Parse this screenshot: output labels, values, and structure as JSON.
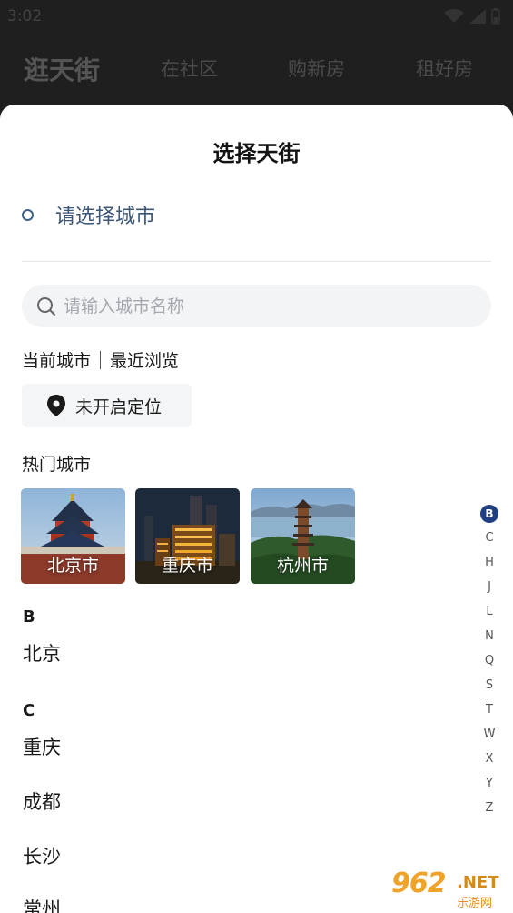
{
  "status_bar": {
    "time": "3:02"
  },
  "background_nav": {
    "tabs": [
      "逛天街",
      "在社区",
      "购新房",
      "租好房"
    ]
  },
  "sheet": {
    "title": "选择天街",
    "select_prompt": "请选择城市",
    "search": {
      "placeholder": "请输入城市名称",
      "value": ""
    },
    "tabs": [
      "当前城市",
      "最近浏览"
    ],
    "location_button": {
      "label": "未开启定位",
      "icon": "location-pin-icon"
    },
    "hot_title": "热门城市",
    "hot_cities": [
      {
        "label": "北京市"
      },
      {
        "label": "重庆市"
      },
      {
        "label": "杭州市"
      }
    ],
    "groups": [
      {
        "letter": "B",
        "cities": [
          "北京"
        ]
      },
      {
        "letter": "C",
        "cities": [
          "重庆",
          "成都",
          "长沙",
          "常州"
        ]
      }
    ],
    "index_letters": [
      "B",
      "C",
      "H",
      "J",
      "L",
      "N",
      "Q",
      "S",
      "T",
      "W",
      "X",
      "Y",
      "Z"
    ],
    "index_active": "B"
  },
  "watermark": {
    "main": "962",
    "net": ".NET",
    "sub": "乐游网"
  },
  "colors": {
    "accent": "#1f3f82",
    "prompt": "#3c5678",
    "watermark": "#f0a32a"
  }
}
